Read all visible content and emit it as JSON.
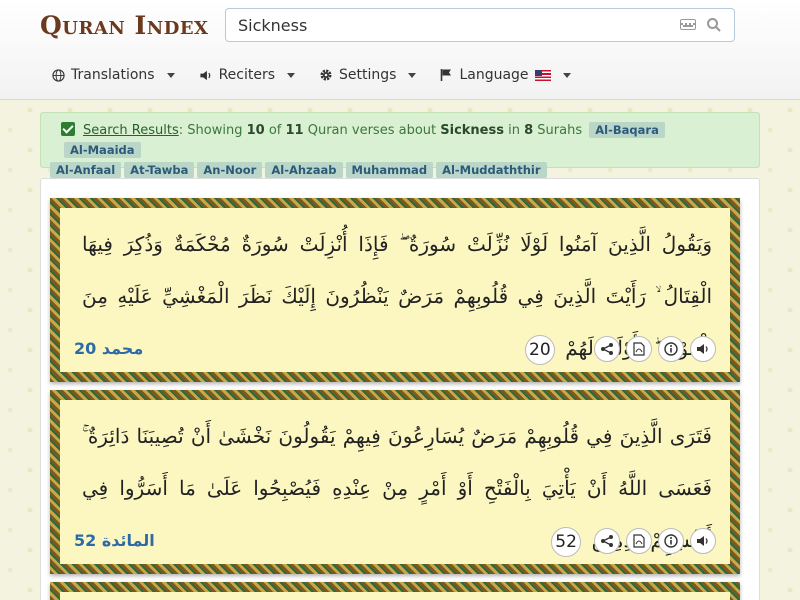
{
  "app": {
    "logo_text": "Quran Index",
    "search_value": "Sickness"
  },
  "nav": [
    {
      "label": "Translations",
      "icon": "globe-icon"
    },
    {
      "label": "Reciters",
      "icon": "volume-icon"
    },
    {
      "label": "Settings",
      "icon": "gear-icon"
    },
    {
      "label": "Language",
      "icon": "flag-icon"
    }
  ],
  "results": {
    "link_text": "Search Results",
    "showing": "Showing",
    "shown_count": "10",
    "of": "of",
    "total_count": "11",
    "about": "Quran verses about",
    "term": "Sickness",
    "in": "in",
    "surah_count": "8",
    "surahs_word": "Surahs",
    "surahs": [
      "Al-Baqara",
      "Al-Maaida",
      "Al-Anfaal",
      "At-Tawba",
      "An-Noor",
      "Al-Ahzaab",
      "Muhammad",
      "Al-Muddaththir"
    ]
  },
  "verses": [
    {
      "text": "وَيَقُولُ الَّذِينَ آمَنُوا لَوْلَا نُزِّلَتْ سُورَةٌ ۖ فَإِذَا أُنْزِلَتْ سُورَةٌ مُحْكَمَةٌ وَذُكِرَ فِيهَا الْقِتَالُ ۙ رَأَيْتَ الَّذِينَ فِي قُلُوبِهِمْ مَرَضٌ يَنْظُرُونَ إِلَيْكَ نَظَرَ الْمَغْشِيِّ عَلَيْهِ مِنَ الْمَوْتِ ۖ فَأَوْلَىٰ لَهُمْ",
      "number": "20",
      "reference": "محمد 20"
    },
    {
      "text": "فَتَرَى الَّذِينَ فِي قُلُوبِهِمْ مَرَضٌ يُسَارِعُونَ فِيهِمْ يَقُولُونَ نَخْشَىٰ أَنْ تُصِيبَنَا دَائِرَةٌ ۚ فَعَسَى اللَّهُ أَنْ يَأْتِيَ بِالْفَتْحِ أَوْ أَمْرٍ مِنْ عِنْدِهِ فَيُصْبِحُوا عَلَىٰ مَا أَسَرُّوا فِي أَنْفُسِهِمْ نَادِمِينَ",
      "number": "52",
      "reference": "المائدة 52"
    }
  ],
  "colors": {
    "accent_blue": "#2c6aa8",
    "alert_bg": "#d9f0d2",
    "verse_bg": "#fcf7c0",
    "logo_brown": "#6b3a1e"
  }
}
